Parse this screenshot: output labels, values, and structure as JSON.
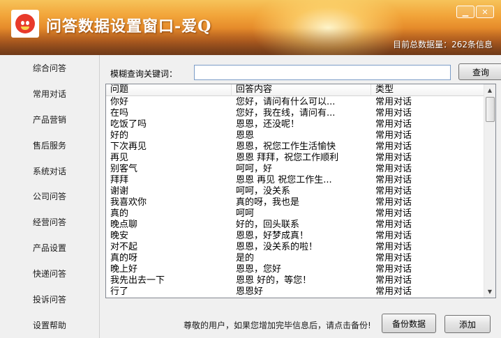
{
  "window": {
    "title": "问答数据设置窗口-爱Q",
    "stats": "目前总数据量：262条信息",
    "minimize_label": "▁",
    "close_label": "✕"
  },
  "sidebar": {
    "items": [
      {
        "label": "综合问答"
      },
      {
        "label": "常用对话"
      },
      {
        "label": "产品营销"
      },
      {
        "label": "售后服务"
      },
      {
        "label": "系统对话"
      },
      {
        "label": "公司问答"
      },
      {
        "label": "经营问答"
      },
      {
        "label": "产品设置"
      },
      {
        "label": "快递问答"
      },
      {
        "label": "投诉问答"
      },
      {
        "label": "设置帮助"
      }
    ]
  },
  "search": {
    "label": "模糊查询关键词：",
    "value": "",
    "placeholder": "",
    "button_label": "查询"
  },
  "table": {
    "headers": [
      "问题",
      "回答内容",
      "类型"
    ],
    "rows": [
      [
        "你好",
        "您好，请问有什么可以...",
        "常用对话"
      ],
      [
        "在吗",
        "您好，我在线，请问有...",
        "常用对话"
      ],
      [
        "吃饭了吗",
        "恩恩，还没呢！",
        "常用对话"
      ],
      [
        "好的",
        "恩恩",
        "常用对话"
      ],
      [
        "下次再见",
        "恩恩，祝您工作生活愉快",
        "常用对话"
      ],
      [
        "再见",
        "恩恩 拜拜，祝您工作顺利",
        "常用对话"
      ],
      [
        "别客气",
        "呵呵，好",
        "常用对话"
      ],
      [
        "拜拜",
        "恩恩 再见 祝您工作生...",
        "常用对话"
      ],
      [
        "谢谢",
        "呵呵，没关系",
        "常用对话"
      ],
      [
        "我喜欢你",
        "真的呀，我也是",
        "常用对话"
      ],
      [
        "真的",
        "呵呵",
        "常用对话"
      ],
      [
        "晚点聊",
        "好的，回头联系",
        "常用对话"
      ],
      [
        "晚安",
        "恩恩，好梦成真！",
        "常用对话"
      ],
      [
        "对不起",
        "恩恩，没关系的啦！",
        "常用对话"
      ],
      [
        "真的呀",
        "是的",
        "常用对话"
      ],
      [
        "晚上好",
        "恩恩，您好",
        "常用对话"
      ],
      [
        "我先出去一下",
        "恩恩 好的，等您！",
        "常用对话"
      ],
      [
        "行了",
        "恩恩好",
        "常用对话"
      ]
    ]
  },
  "footer": {
    "note": "尊敬的用户，如果您增加完毕信息后，请点击备份!",
    "backup_label": "备份数据",
    "add_label": "添加"
  }
}
